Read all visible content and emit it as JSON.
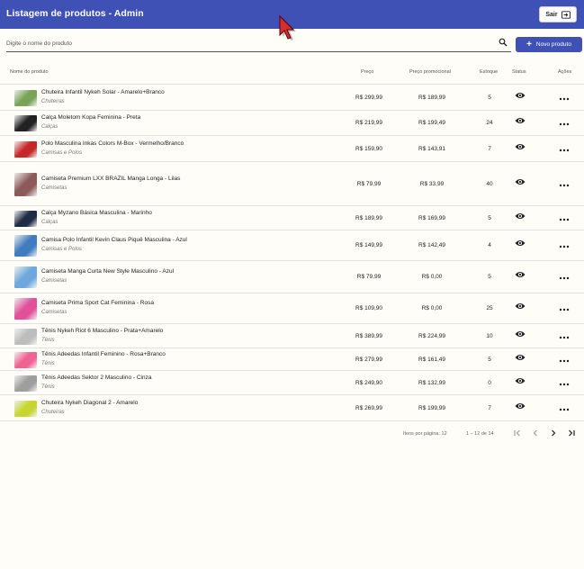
{
  "header": {
    "title": "Listagem de produtos - Admin",
    "logout_label": "Sair"
  },
  "search": {
    "placeholder": "Digite o nome do produto"
  },
  "new_product_label": "Novo produto",
  "columns": {
    "name": "Nome do produto",
    "price": "Preço",
    "promo": "Preço promocional",
    "stock": "Estoque",
    "status": "Status",
    "actions": "Ações"
  },
  "products": [
    {
      "name": "Chuteira Infantil Nykeh Solar - Amarelo+Branco",
      "category": "Chuteiras",
      "price": "R$ 299,99",
      "promo": "R$ 189,99",
      "stock": "5",
      "thumb_color": "#7aa35a"
    },
    {
      "name": "Calça Moletom Kopa Feminina - Preta",
      "category": "Calças",
      "price": "R$ 219,99",
      "promo": "R$ 199,49",
      "stock": "24",
      "thumb_color": "#222222"
    },
    {
      "name": "Polo Masculina Inkas Colors M-Box - Vermelho/Branco",
      "category": "Camisas e Polos",
      "price": "R$ 159,90",
      "promo": "R$ 143,91",
      "stock": "7",
      "thumb_color": "#c62828"
    },
    {
      "name": "Camiseta Premium LXX BRAZIL Manga Longa - Lilas",
      "category": "Camisetas",
      "price": "R$ 79,99",
      "promo": "R$ 33,99",
      "stock": "40",
      "thumb_color": "#8d5a5a"
    },
    {
      "name": "Calça Myzano Básica Masculina - Marinho",
      "category": "Calças",
      "price": "R$ 189,99",
      "promo": "R$ 169,99",
      "stock": "5",
      "thumb_color": "#1f2a44"
    },
    {
      "name": "Camisa Polo Infantil Kevin Claus Piquê Masculina - Azul",
      "category": "Camisas e Polos",
      "price": "R$ 149,99",
      "promo": "R$ 142,49",
      "stock": "4",
      "thumb_color": "#3f7cc0"
    },
    {
      "name": "Camiseta Manga Curta New Style Masculino - Azul",
      "category": "Camisetas",
      "price": "R$ 79,99",
      "promo": "R$ 0,00",
      "stock": "5",
      "thumb_color": "#6fa8dc"
    },
    {
      "name": "Camiseta Prima Sport Cat Feminina - Rosa",
      "category": "Camisetas",
      "price": "R$ 109,90",
      "promo": "R$ 0,00",
      "stock": "25",
      "thumb_color": "#e0519a"
    },
    {
      "name": "Tênis Nykeh Riot 6 Masculino - Prata+Amarelo",
      "category": "Tênis",
      "price": "R$ 389,99",
      "promo": "R$ 224,99",
      "stock": "10",
      "thumb_color": "#bdbdbd"
    },
    {
      "name": "Tênis Adeedas Infantil Feminino - Rosa+Branco",
      "category": "Tênis",
      "price": "R$ 279,99",
      "promo": "R$ 161,49",
      "stock": "5",
      "thumb_color": "#f06292"
    },
    {
      "name": "Tênis Adeedas Sektor 2 Masculino - Cinza",
      "category": "Tênis",
      "price": "R$ 249,90",
      "promo": "R$ 132,99",
      "stock": "0",
      "thumb_color": "#9e9e9e"
    },
    {
      "name": "Chuteira Nykeh Diagonal 2 - Amarelo",
      "category": "Chuteiras",
      "price": "R$ 269,99",
      "promo": "R$ 199,99",
      "stock": "7",
      "thumb_color": "#c6d62e"
    }
  ],
  "pagination": {
    "items_per_page_label": "Itens por página:",
    "items_per_page": "12",
    "range": "1 – 12 de 14"
  },
  "colors": {
    "primary": "#3f51b5"
  }
}
